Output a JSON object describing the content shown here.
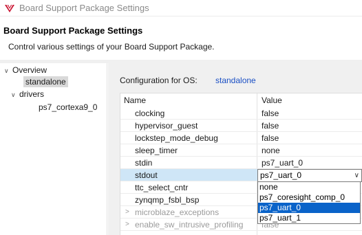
{
  "window": {
    "title": "Board Support Package Settings",
    "logo_icon": "app-logo-icon"
  },
  "header": {
    "title": "Board Support Package Settings",
    "description": "Control various settings of your Board Support Package."
  },
  "nav": {
    "items": [
      {
        "label": "Overview",
        "expander": "∨"
      },
      {
        "label": "standalone"
      },
      {
        "label": "drivers",
        "expander": "∨"
      },
      {
        "label": "ps7_cortexa9_0"
      }
    ]
  },
  "config": {
    "label": "Configuration for OS:",
    "value": "standalone"
  },
  "table": {
    "columns": [
      "Name",
      "Value"
    ],
    "rows": [
      {
        "name": "clocking",
        "value": "false"
      },
      {
        "name": "hypervisor_guest",
        "value": "false"
      },
      {
        "name": "lockstep_mode_debug",
        "value": "false"
      },
      {
        "name": "sleep_timer",
        "value": "none"
      },
      {
        "name": "stdin",
        "value": "ps7_uart_0"
      },
      {
        "name": "stdout",
        "value": "ps7_uart_0"
      },
      {
        "name": "ttc_select_cntr",
        "value": ""
      },
      {
        "name": "zynqmp_fsbl_bsp",
        "value": ""
      },
      {
        "name": "microblaze_exceptions",
        "value": "",
        "expander": ">"
      },
      {
        "name": "enable_sw_intrusive_profiling",
        "value": "false",
        "expander": ">"
      }
    ]
  },
  "dropdown": {
    "selected_value": "ps7_uart_0",
    "arrow": "∨",
    "options": [
      "none",
      "ps7_coresight_comp_0",
      "ps7_uart_0",
      "ps7_uart_1"
    ],
    "highlighted": "ps7_uart_0"
  },
  "colors": {
    "link": "#1a4fc4",
    "row_selected": "#cfe6f7",
    "option_highlight": "#0a63c9",
    "logo": "#c8102e"
  }
}
